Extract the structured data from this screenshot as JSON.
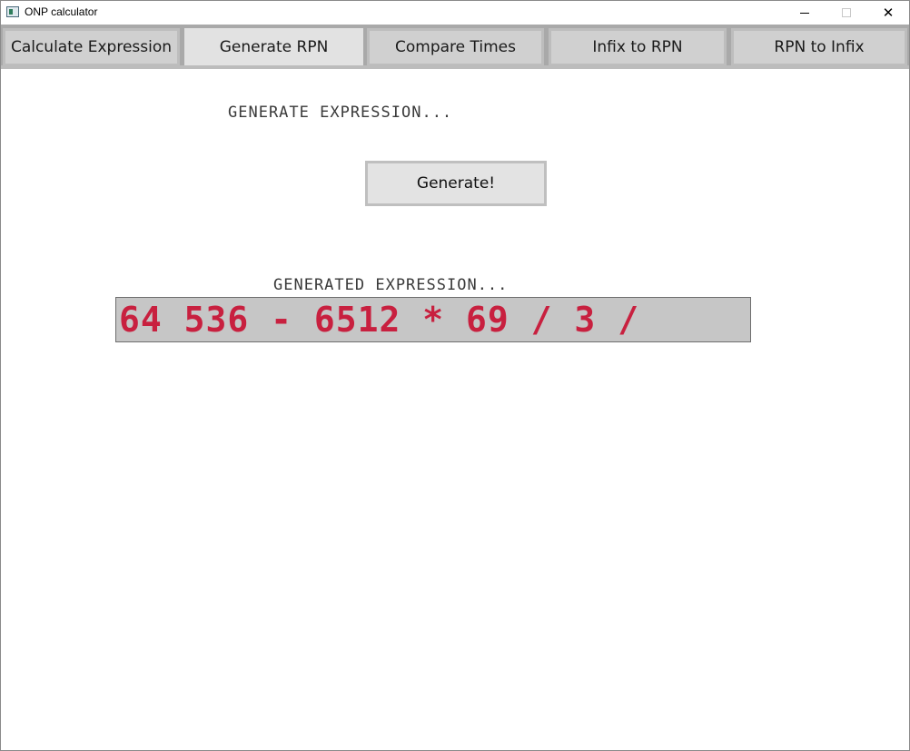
{
  "window": {
    "title": "ONP calculator",
    "icons": {
      "app": "app-window-icon",
      "minimize": "minimize-icon",
      "maximize": "maximize-icon",
      "close": "close-icon"
    },
    "close_glyph": "✕"
  },
  "tabs": [
    {
      "label": "Calculate Expression",
      "active": false
    },
    {
      "label": "Generate RPN",
      "active": true
    },
    {
      "label": "Compare Times",
      "active": false
    },
    {
      "label": "Infix to RPN",
      "active": false
    },
    {
      "label": "RPN to Infix",
      "active": false
    }
  ],
  "main": {
    "generate_label": "GENERATE EXPRESSION...",
    "generate_button": "Generate!",
    "generated_label": "GENERATED EXPRESSION...",
    "generated_expression": "64 536 - 6512 * 69 / 3 /"
  },
  "colors": {
    "expression_text": "#c8203f",
    "expression_bg": "#c6c6c6",
    "tab_active": "#e2e2e2",
    "tab_inactive": "#d0d0d0"
  }
}
